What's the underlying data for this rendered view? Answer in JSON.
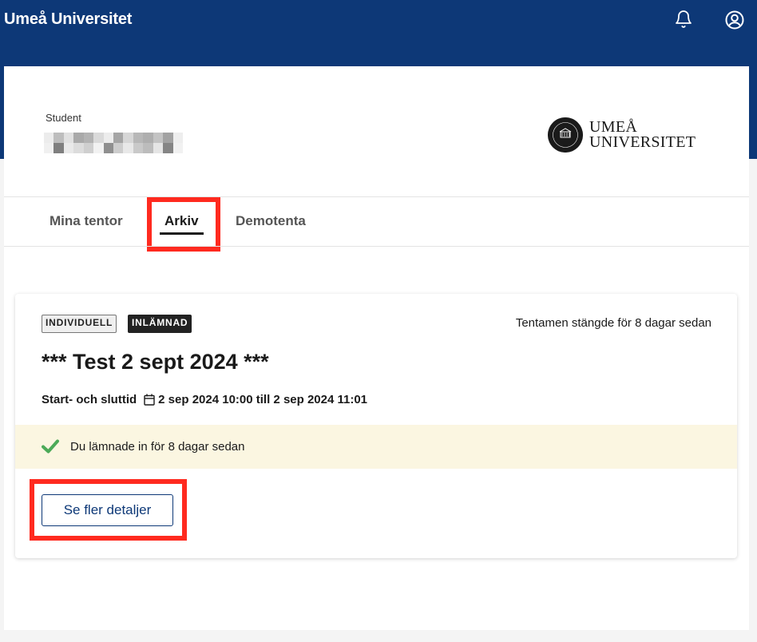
{
  "header": {
    "brand": "Umeå Universitet",
    "icons": [
      "bell-icon",
      "user-icon"
    ]
  },
  "profile": {
    "role_label": "Student",
    "name": "(blurred)"
  },
  "logo": {
    "line1": "UMEÅ",
    "line2": "UNIVERSITET"
  },
  "tabs": [
    {
      "label": "Mina tentor",
      "active": false
    },
    {
      "label": "Arkiv",
      "active": true
    },
    {
      "label": "Demotenta",
      "active": false
    }
  ],
  "exam": {
    "badges": [
      "INDIVIDUELL",
      "INLÄMNAD"
    ],
    "closed_text": "Tentamen stängde för 8 dagar sedan",
    "title": "*** Test 2 sept 2024 ***",
    "time_label": "Start- och sluttid",
    "time_value": "2 sep 2024 10:00 till 2 sep 2024 11:01",
    "submitted_text": "Du lämnade in för 8 dagar sedan",
    "details_button": "Se fler detaljer"
  },
  "colors": {
    "header_bg": "#0d3877",
    "highlight": "#ff2a1f",
    "notice_bg": "#fbf6e1",
    "check": "#4caa58"
  }
}
